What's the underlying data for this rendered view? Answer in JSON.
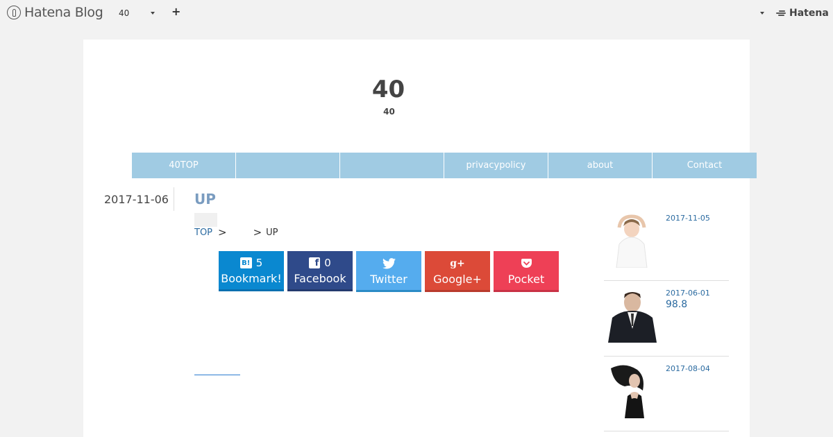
{
  "topbar": {
    "logo_text": "Hatena Blog",
    "blog_select": "40",
    "add_label": "+",
    "hatena_label": "Hatena"
  },
  "site": {
    "title": "40",
    "subtitle": "40"
  },
  "nav": {
    "items": [
      {
        "label": "40TOP"
      },
      {
        "label": ""
      },
      {
        "label": ""
      },
      {
        "label": "privacypolicy"
      },
      {
        "label": "about"
      },
      {
        "label": "Contact"
      }
    ]
  },
  "entry": {
    "date": "2017-11-06",
    "title": "UP",
    "breadcrumb": {
      "top": "TOP",
      "sep": ">",
      "current": "UP"
    }
  },
  "share": {
    "hatena": {
      "count": "5",
      "label": "Bookmark!",
      "icon": "hatena-bookmark-icon"
    },
    "facebook": {
      "count": "0",
      "label": "Facebook",
      "icon": "facebook-icon"
    },
    "twitter": {
      "label": "Twitter",
      "icon": "twitter-icon"
    },
    "google": {
      "label": "Google+",
      "icon": "google-plus-icon"
    },
    "pocket": {
      "label": "Pocket",
      "icon": "pocket-icon"
    }
  },
  "sidebar": {
    "items": [
      {
        "date": "2017-11-05",
        "title": ""
      },
      {
        "date": "2017-06-01",
        "title": "98.8"
      },
      {
        "date": "2017-08-04",
        "title": ""
      }
    ]
  },
  "colors": {
    "nav_bg": "#a0cbe3",
    "title_blue": "#7a9cc0",
    "link": "#2a6aa0",
    "hatena": "#0a88d0",
    "facebook": "#2f4a8a",
    "twitter": "#55acee",
    "google": "#dc4a38",
    "pocket": "#ee4056"
  }
}
